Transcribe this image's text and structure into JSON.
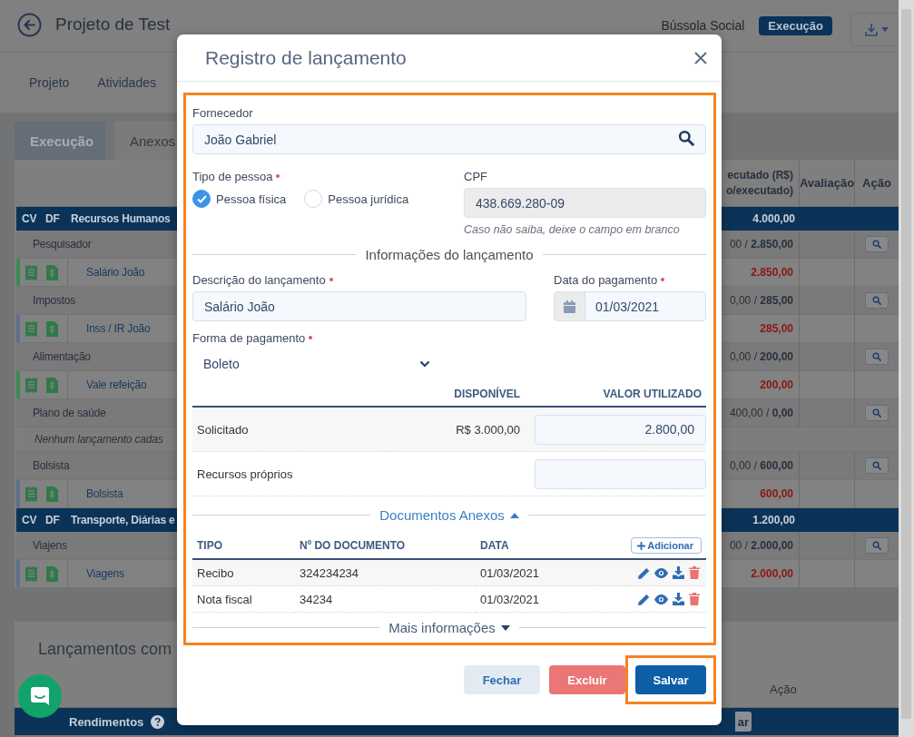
{
  "header": {
    "back": true,
    "title": "Projeto de Test",
    "org": "Bússola Social",
    "status": "Execução"
  },
  "nav": [
    {
      "label": "Projeto"
    },
    {
      "label": "Atividades"
    }
  ],
  "tabs": [
    {
      "label": "Execução",
      "selected": true
    },
    {
      "label": "Anexos",
      "selected": false
    }
  ],
  "table": {
    "columns": [
      {
        "lines": [
          "ecutado (R$)",
          "o/executado)"
        ]
      },
      {
        "lines": [
          "Avaliação"
        ]
      },
      {
        "lines": [
          "Ação"
        ]
      }
    ],
    "rows": [
      {
        "kind": "group",
        "cv": "CV",
        "df": "DF",
        "name": "Recursos Humanos",
        "total": "4.000,00"
      },
      {
        "kind": "category",
        "name": "Pesquisador",
        "executed": "00 / **2.850,00**",
        "search": true
      },
      {
        "kind": "entry",
        "color": "#3a8a55",
        "name": "Salário João",
        "value": "2.850,00"
      },
      {
        "kind": "category",
        "name": "Impostos",
        "executed": "0,00 / **285,00**",
        "search": true
      },
      {
        "kind": "entry",
        "color": "#5f6f8e",
        "name": "Inss / IR João",
        "value": "285,00"
      },
      {
        "kind": "category",
        "name": "Alimentação",
        "executed": "0,00 / **200,00**",
        "search": true
      },
      {
        "kind": "entry",
        "color": "#3a8a55",
        "name": "Vale refeição",
        "value": "200,00"
      },
      {
        "kind": "category",
        "name": "Plano de saúde",
        "executed": "400,00 / **0,00**",
        "search": true
      },
      {
        "kind": "empty",
        "text": "Nenhum lançamento cadas"
      },
      {
        "kind": "category",
        "name": "Bolsista",
        "executed": "0,00 / **600,00**",
        "search": true
      },
      {
        "kind": "entry",
        "color": "#5f6f8e",
        "name": "Bolsista",
        "value": "600,00"
      },
      {
        "kind": "group",
        "cv": "CV",
        "df": "DF",
        "name": "Transporte, Diárias e",
        "total": "1.200,00"
      },
      {
        "kind": "category",
        "name": "Viajens",
        "executed": "00 / **2.000,00**",
        "search": true
      },
      {
        "kind": "entry",
        "color": "#5f6f8e",
        "name": "Viagens",
        "value": "2.000,00"
      }
    ]
  },
  "bottom_panel": {
    "title": "Lançamentos com",
    "column": "Ação",
    "group": {
      "name": "Rendimentos",
      "button": "ar"
    }
  },
  "modal": {
    "title": "Registro de lançamento",
    "form": {
      "highlighted": true,
      "supplier": {
        "label": "Fornecedor",
        "value": "João Gabriel"
      },
      "person_type": {
        "label": "Tipo de pessoa",
        "required": true,
        "options": [
          {
            "label": "Pessoa física",
            "selected": true
          },
          {
            "label": "Pessoa jurídica",
            "selected": false
          }
        ]
      },
      "cpf": {
        "label": "CPF",
        "value": "438.669.280-09",
        "disabled": true,
        "hint": "Caso não saiba, deixe o campo em branco"
      },
      "section": "Informações do lançamento",
      "description": {
        "label": "Descrição do lançamento",
        "required": true,
        "value": "Salário João"
      },
      "payment_date": {
        "label": "Data do pagamento",
        "required": true,
        "value": "01/03/2021"
      },
      "payment_method": {
        "label": "Forma de pagamento",
        "required": true,
        "value": "Boleto"
      },
      "resources": {
        "columns": [
          "DISPONÍVEL",
          "VALOR UTILIZADO"
        ],
        "rows": [
          {
            "label": "Solicitado",
            "available": "R$ 3.000,00",
            "value": "2.800,00"
          },
          {
            "label": "Recursos próprios"
          }
        ]
      },
      "attachments": {
        "title": "Documentos Anexos",
        "expanded": true,
        "columns": [
          "TIPO",
          "Nº DO DOCUMENTO",
          "DATA"
        ],
        "add_button": "Adicionar",
        "rows": [
          {
            "type": "Recibo",
            "number": "324234234",
            "date": "01/03/2021"
          },
          {
            "type": "Nota fiscal",
            "number": "34234",
            "date": "01/03/2021"
          }
        ]
      },
      "more": {
        "title": "Mais informações",
        "expanded": false
      }
    },
    "buttons": [
      {
        "label": "Fechar",
        "kind": "secondary",
        "highlighted": false
      },
      {
        "label": "Excluir",
        "kind": "danger",
        "highlighted": false
      },
      {
        "label": "Salvar",
        "kind": "primary",
        "highlighted": true
      }
    ]
  }
}
